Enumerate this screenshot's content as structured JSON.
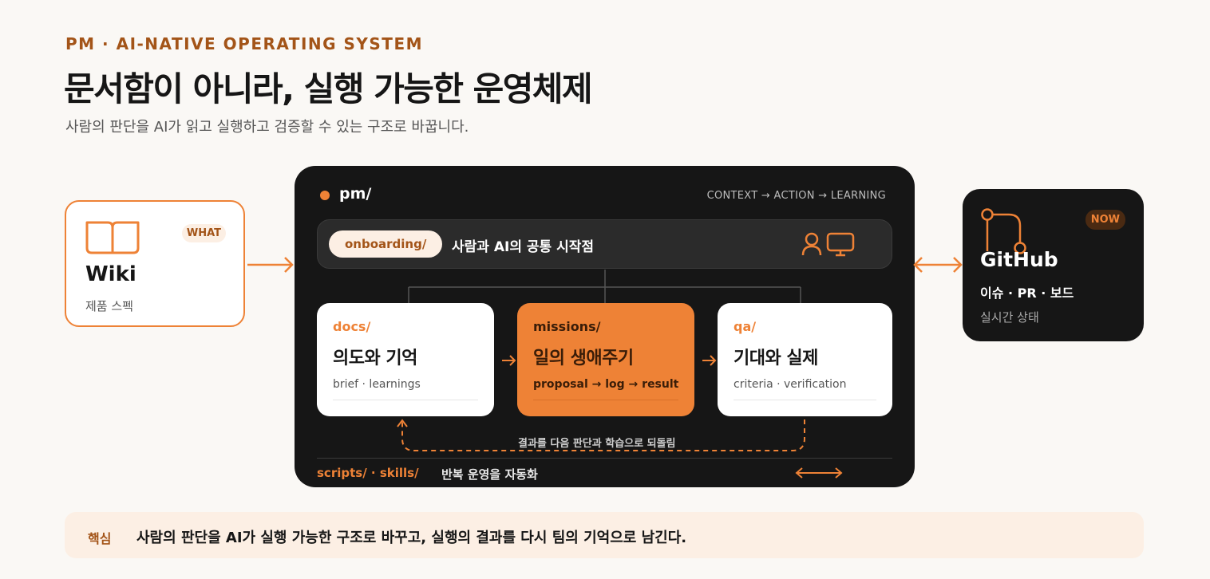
{
  "header": {
    "eyebrow": "PM · AI-NATIVE OPERATING SYSTEM",
    "title": "문서함이 아니라, 실행 가능한 운영체제",
    "subtitle": "사람의 판단을 AI가 읽고 실행하고 검증할 수 있는 구조로 바꿉니다."
  },
  "wiki": {
    "badge": "WHAT",
    "name": "Wiki",
    "desc": "제품 스펙",
    "icon": "book-icon"
  },
  "panel": {
    "root": "pm/",
    "flow": "CONTEXT → ACTION → LEARNING",
    "onboarding": {
      "path": "onboarding/",
      "label": "사람과 AI의 공통 시작점",
      "icons": [
        "person-icon",
        "monitor-icon"
      ]
    },
    "cards": [
      {
        "path": "docs/",
        "head": "의도와 기억",
        "meta": "brief · learnings"
      },
      {
        "path": "missions/",
        "head": "일의 생애주기",
        "meta": "proposal → log → result"
      },
      {
        "path": "qa/",
        "head": "기대와 실제",
        "meta": "criteria · verification"
      }
    ],
    "feedback": "결과를 다음 판단과 학습으로 되돌림",
    "scripts": "scripts/ · skills/",
    "scripts_desc": "반복 운영을 자동화"
  },
  "github": {
    "badge": "NOW",
    "name": "GitHub",
    "sub": "이슈 · PR · 보드",
    "desc": "실시간 상태",
    "icon": "git-branch-icon"
  },
  "key": {
    "tag": "핵심",
    "text": "사람의 판단을 AI가 실행 가능한 구조로 바꾸고, 실행의 결과를 다시 팀의 기억으로 남긴다."
  },
  "colors": {
    "accent": "#ee8236",
    "accent_dark": "#a35418",
    "panel": "#161616",
    "background": "#faf8f5"
  }
}
